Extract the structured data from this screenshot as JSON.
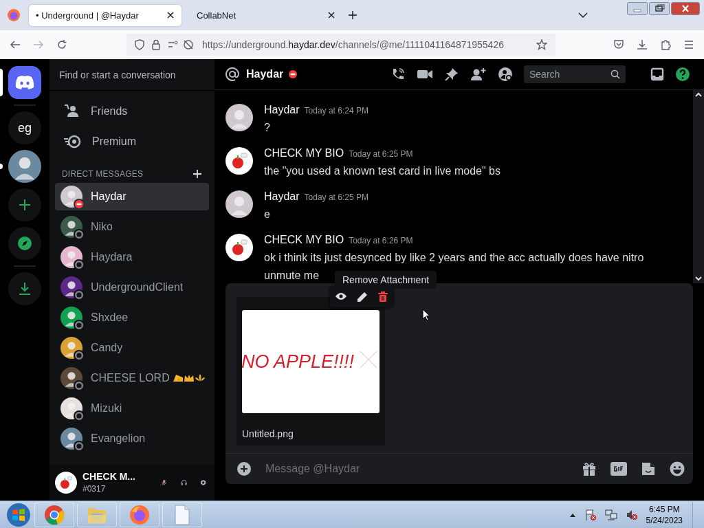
{
  "browser": {
    "tabs": [
      {
        "label": "• Underground | @Haydar",
        "selected": true
      },
      {
        "label": "CollabNet",
        "selected": false
      }
    ],
    "url": {
      "prefix": "https://underground.",
      "domain": "haydar.dev",
      "path": "/channels/@me/1111041164871955426"
    }
  },
  "servers": [
    {
      "kind": "home",
      "selected": true,
      "unread": false
    },
    {
      "kind": "text",
      "label": "eg",
      "selected": false,
      "unread": false
    },
    {
      "kind": "avatar",
      "selected": false,
      "unread": true
    },
    {
      "kind": "add",
      "selected": false,
      "unread": false
    },
    {
      "kind": "explore",
      "selected": false,
      "unread": false
    },
    {
      "kind": "download",
      "selected": false,
      "unread": false
    }
  ],
  "sidebar": {
    "search_placeholder": "Find or start a conversation",
    "nav": [
      {
        "kind": "friends",
        "label": "Friends"
      },
      {
        "kind": "premium",
        "label": "Premium"
      }
    ],
    "section_title": "DIRECT MESSAGES",
    "dms": [
      {
        "name": "Haydar",
        "dnd": true,
        "selected": true,
        "emojis": false
      },
      {
        "name": "Niko",
        "dnd": false,
        "selected": false,
        "emojis": false
      },
      {
        "name": "Haydara",
        "dnd": false,
        "selected": false,
        "emojis": false
      },
      {
        "name": "UndergroundClient",
        "dnd": false,
        "selected": false,
        "emojis": false
      },
      {
        "name": "Shxdee",
        "dnd": false,
        "selected": false,
        "emojis": false
      },
      {
        "name": "Candy",
        "dnd": false,
        "selected": false,
        "emojis": false
      },
      {
        "name": "CHEESE LORD",
        "dnd": false,
        "selected": false,
        "emojis": true
      },
      {
        "name": "Mizuki",
        "dnd": false,
        "selected": false,
        "emojis": false
      },
      {
        "name": "Evangelion",
        "dnd": false,
        "selected": false,
        "emojis": false
      }
    ],
    "user": {
      "name": "CHECK M...",
      "tag": "#0317",
      "mic_muted": true
    }
  },
  "chat": {
    "header": {
      "name": "Haydar",
      "dnd": true,
      "search_placeholder": "Search"
    },
    "messages": [
      {
        "author": "Haydar",
        "kind": "figure",
        "time": "Today at 6:24 PM",
        "lines": [
          "?"
        ]
      },
      {
        "author": "CHECK MY BIO",
        "kind": "apple",
        "time": "Today at 6:25 PM",
        "lines": [
          "the \"you used a known test card in live mode\" bs"
        ]
      },
      {
        "author": "Haydar",
        "kind": "figure",
        "time": "Today at 6:25 PM",
        "lines": [
          "e"
        ]
      },
      {
        "author": "CHECK MY BIO",
        "kind": "apple",
        "time": "Today at 6:26 PM",
        "lines": [
          "ok i think its just desynced by like 2 years and the acc actually does have nitro",
          "unmute me"
        ]
      }
    ],
    "tooltip": "Remove Attachment",
    "attachment": {
      "image_text": "NO APPLE!!!!",
      "filename": "Untitled.png"
    },
    "composer_placeholder": "Message @Haydar"
  },
  "taskbar": {
    "apps": [
      {
        "kind": "chrome"
      },
      {
        "kind": "folder"
      },
      {
        "kind": "firefox"
      },
      {
        "kind": "document"
      }
    ],
    "time": "6:45 PM",
    "date": "5/24/2023"
  }
}
